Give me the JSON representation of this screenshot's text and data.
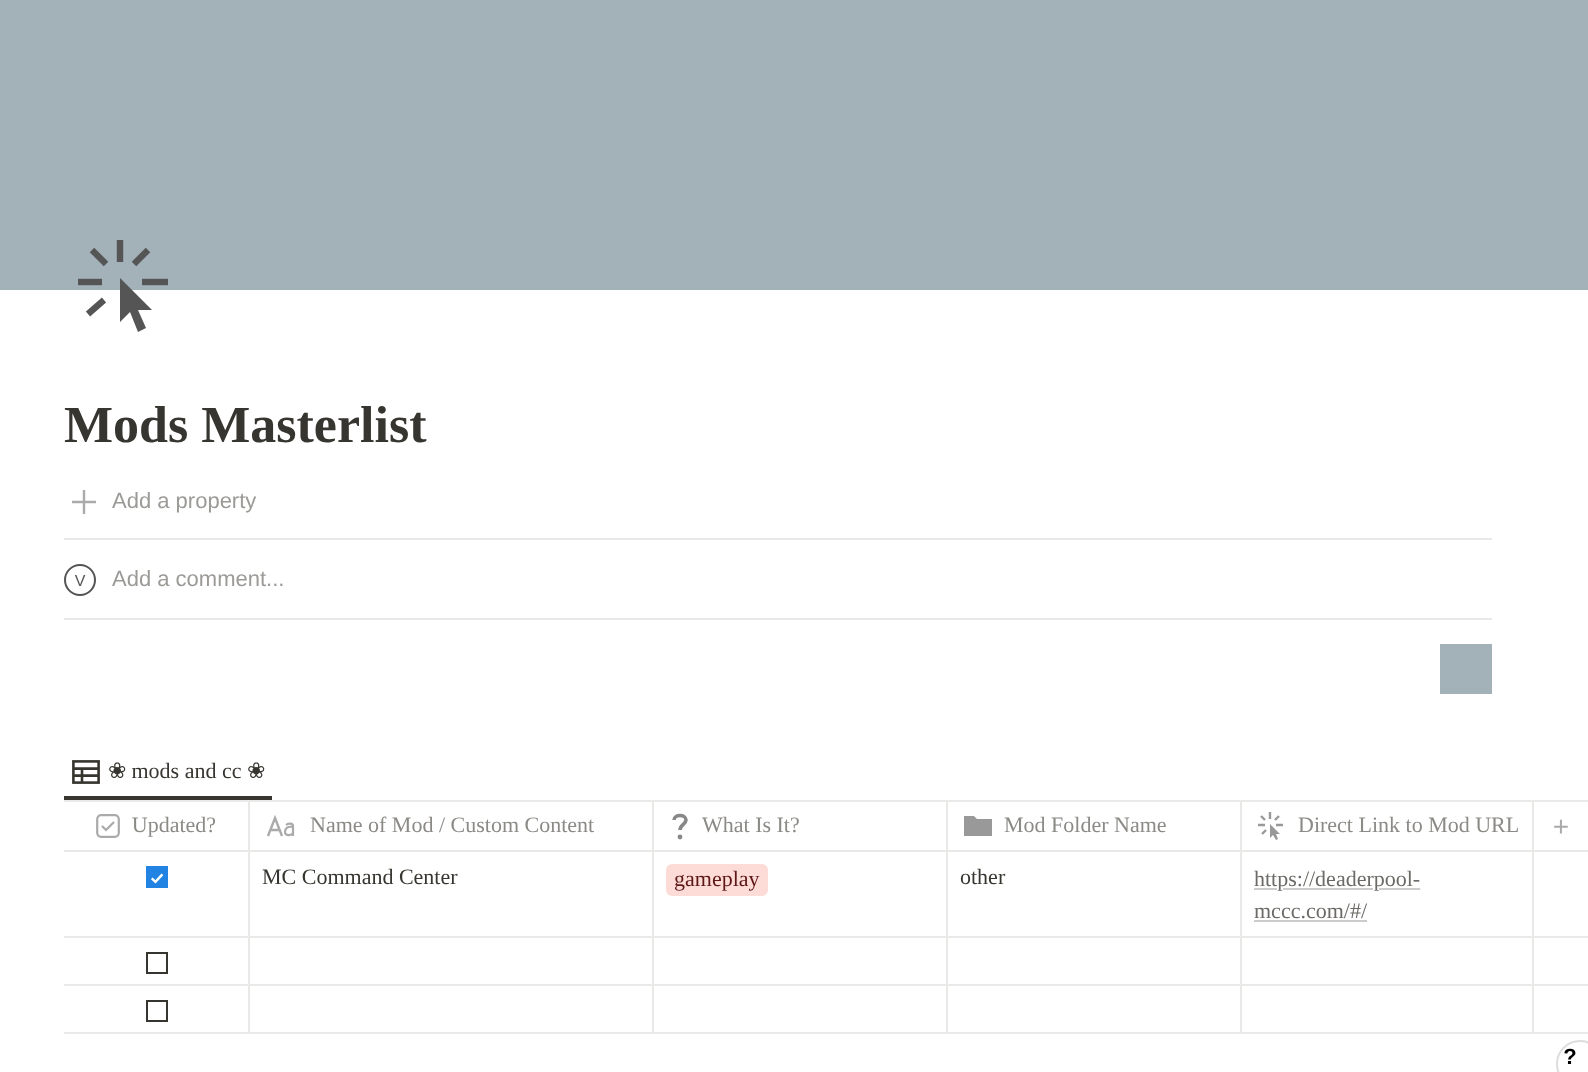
{
  "page": {
    "title": "Mods Masterlist",
    "add_property": "Add a property",
    "comment_avatar": "V",
    "comment_placeholder": "Add a comment..."
  },
  "view_tab": {
    "label": "❀ mods and cc ❀",
    "selected": true
  },
  "table": {
    "columns": [
      {
        "label": "Updated?",
        "kind": "checkbox"
      },
      {
        "label": "Name of Mod / Custom Content",
        "kind": "title"
      },
      {
        "label": "What Is It?",
        "kind": "select"
      },
      {
        "label": "Mod Folder Name",
        "kind": "folder"
      },
      {
        "label": "Direct Link to Mod URL",
        "kind": "url"
      }
    ],
    "add_column": "+",
    "rows": [
      {
        "updated": true,
        "name": "MC Command Center",
        "what": {
          "label": "gameplay",
          "color": "#fddcd8"
        },
        "folder": "other",
        "link": "https://deaderpool-mccc.com/#/"
      },
      {
        "updated": false
      },
      {
        "updated": false
      }
    ]
  },
  "help_button": "?"
}
